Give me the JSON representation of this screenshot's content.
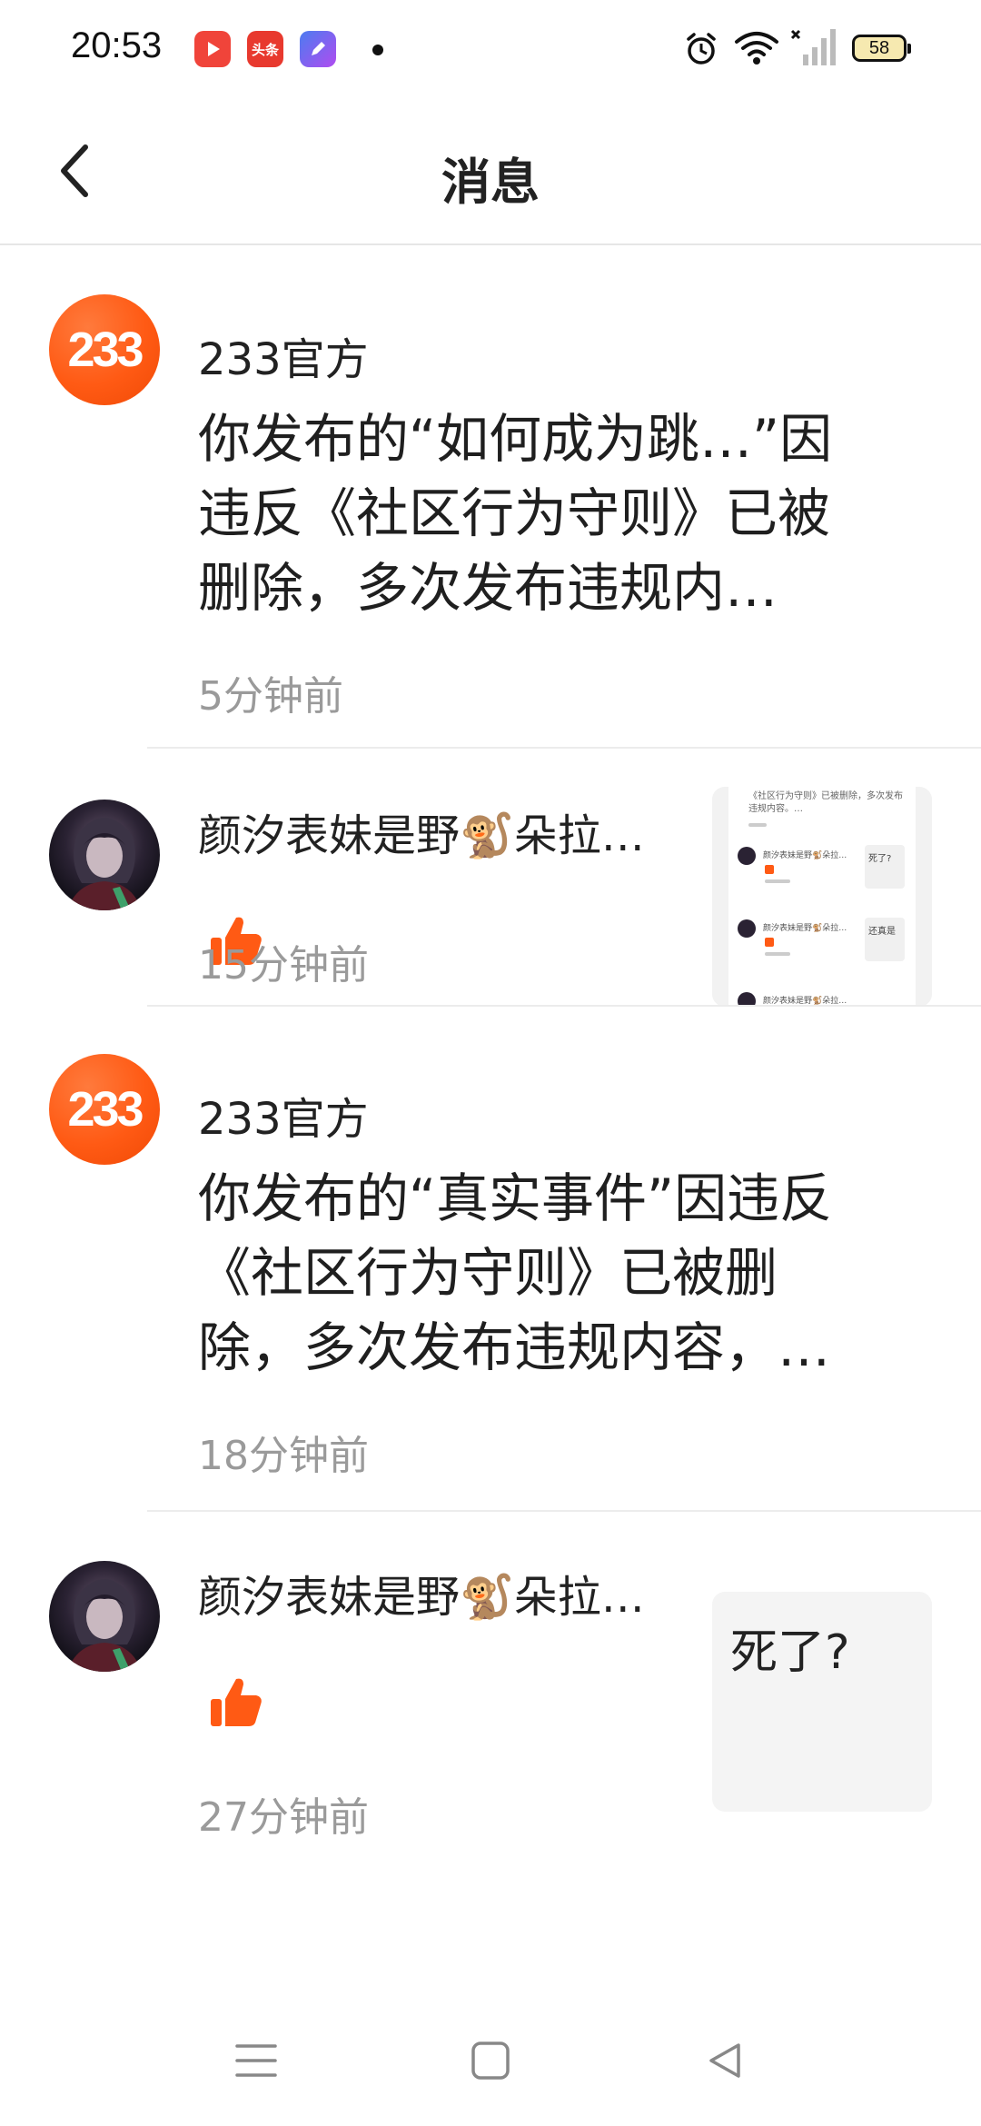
{
  "status_bar": {
    "time": "20:53",
    "battery": "58",
    "apps": [
      {
        "name": "video-app-icon",
        "label": "▶",
        "color": "#f0443a"
      },
      {
        "name": "toutiao-app-icon",
        "label": "头条",
        "color": "#e8392e"
      },
      {
        "name": "pen-app-icon",
        "label": "✎",
        "color": "#6a4cf0"
      }
    ]
  },
  "header": {
    "title": "消息"
  },
  "messages": [
    {
      "sender": "233官方",
      "content": "你发布的“如何成为跳…”因违反《社区行为守则》已被删除，多次发布违规内…",
      "time": "5分钟前"
    },
    {
      "sender": "颜汐表妹是野🐒朵拉…",
      "time": "15分钟前",
      "thumbnail": {
        "title": "《社区行为守则》已被删除，多次发布违规内容。…",
        "items": [
          "颜汐表妹是野🐒朵拉…",
          "颜汐表妹是野🐒朵拉…",
          "颜汐表妹是野🐒朵拉…"
        ],
        "replies": [
          "死了?",
          "还真是"
        ]
      }
    },
    {
      "sender": "233官方",
      "content": "你发布的“真实事件”因违反《社区行为守则》已被删除，多次发布违规内容，…",
      "time": "18分钟前"
    },
    {
      "sender": "颜汐表妹是野🐒朵拉…",
      "time": "27分钟前",
      "reply_text": "死了?"
    }
  ],
  "colors": {
    "accent": "#ff5a14",
    "divider": "#ececec",
    "time_gray": "#9a9a9a"
  }
}
